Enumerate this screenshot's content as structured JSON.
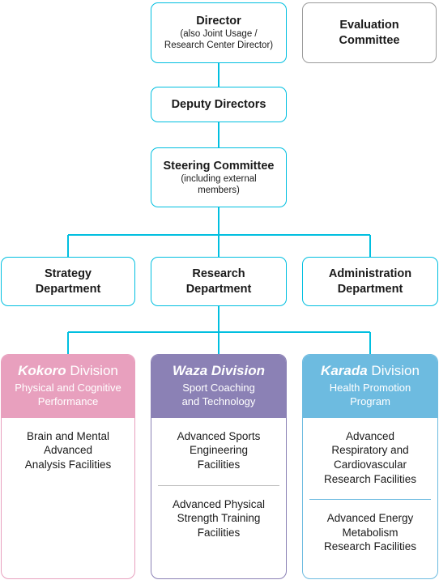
{
  "theme": {
    "line_color": "#00BFE0",
    "gray_border": "#9A9A9A",
    "kokoro_color": "#E8A0BE",
    "waza_color": "#8B81B5",
    "karada_color": "#6DBBE0"
  },
  "nodes": {
    "director": {
      "title": "Director",
      "subtitle": "(also Joint Usage /\nResearch Center Director)"
    },
    "evaluation_committee": {
      "title": "Evaluation\nCommittee"
    },
    "deputy_directors": {
      "title": "Deputy Directors"
    },
    "steering_committee": {
      "title": "Steering Committee",
      "subtitle": "(including external\nmembers)"
    },
    "strategy_department": {
      "title": "Strategy\nDepartment"
    },
    "research_department": {
      "title": "Research\nDepartment"
    },
    "administration_department": {
      "title": "Administration\nDepartment"
    }
  },
  "divisions": [
    {
      "key": "kokoro",
      "name_italic": "Kokoro",
      "name_rest": " Division",
      "name_full": "Kokoro Division",
      "tagline": "Physical and Cognitive\nPerformance",
      "color": "#E8A0BE",
      "facilities": [
        "Brain and Mental\nAdvanced\nAnalysis Facilities"
      ]
    },
    {
      "key": "waza",
      "name_italic": "Waza Division",
      "name_rest": "",
      "name_full": "Waza Division",
      "tagline": "Sport Coaching\nand Technology",
      "color": "#8B81B5",
      "facilities": [
        "Advanced Sports\nEngineering\nFacilities",
        "Advanced Physical\nStrength Training\nFacilities"
      ]
    },
    {
      "key": "karada",
      "name_italic": "Karada",
      "name_rest": " Division",
      "name_full": "Karada Division",
      "tagline": "Health Promotion\nProgram",
      "color": "#6DBBE0",
      "facilities": [
        "Advanced\nRespiratory and\nCardiovascular\nResearch Facilities",
        "Advanced Energy\nMetabolism\nResearch Facilities"
      ]
    }
  ]
}
